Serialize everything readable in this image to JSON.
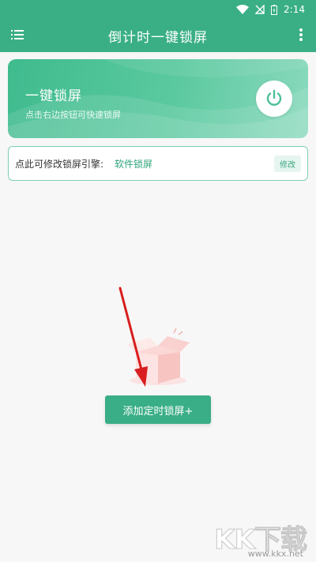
{
  "status_bar": {
    "time": "2:14",
    "icons": [
      "wifi-icon",
      "signal-off-icon",
      "battery-icon"
    ]
  },
  "app_bar": {
    "title": "倒计时一键锁屏",
    "left_icon": "menu-list-icon",
    "right_icon": "more-vertical-icon"
  },
  "lock_card": {
    "title": "一键锁屏",
    "subtitle": "点击右边按钮可快速锁屏",
    "button_icon": "power-icon"
  },
  "engine": {
    "label": "点此可修改锁屏引擎:",
    "value": "软件锁屏",
    "edit_label": "修改"
  },
  "empty_state": {
    "illustration": "empty-box-icon"
  },
  "add_button": {
    "label": "添加定时锁屏+"
  },
  "watermark": {
    "brand": "KK下载",
    "url": "www.kkx.net"
  },
  "colors": {
    "primary": "#3aaf86",
    "accent_text": "#2fa47a",
    "arrow": "#d81e1e"
  }
}
